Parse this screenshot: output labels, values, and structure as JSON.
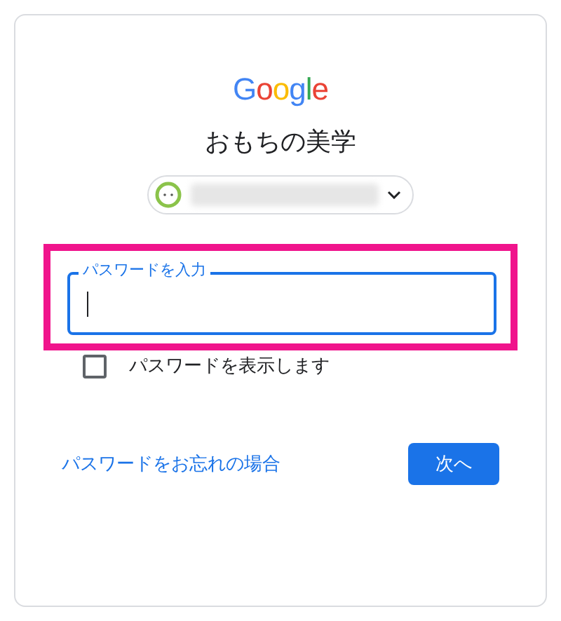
{
  "logo": "Google",
  "title": "おもちの美学",
  "account": {
    "email_blurred": true
  },
  "password": {
    "label": "パスワードを入力",
    "focused": true,
    "highlighted": true
  },
  "show_password": {
    "label": "パスワードを表示します",
    "checked": false
  },
  "forgot_link": "パスワードをお忘れの場合",
  "next_button": "次へ"
}
